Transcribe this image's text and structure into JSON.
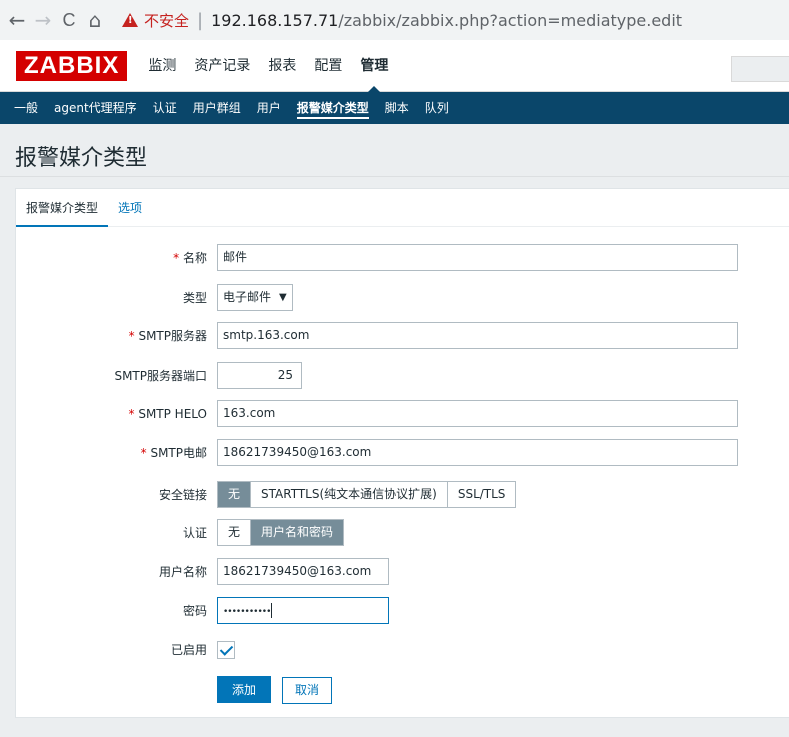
{
  "browser": {
    "back": "←",
    "forward": "→",
    "reload": "C",
    "home": "⌂",
    "security_label": "不安全",
    "host": "192.168.157.71",
    "path": "/zabbix/zabbix.php?action=mediatype.edit"
  },
  "header": {
    "logo": "ZABBIX",
    "menu": [
      "监测",
      "资产记录",
      "报表",
      "配置",
      "管理"
    ],
    "active_menu": "管理"
  },
  "subnav": {
    "items": [
      "一般",
      "agent代理程序",
      "认证",
      "用户群组",
      "用户",
      "报警媒介类型",
      "脚本",
      "队列"
    ],
    "active": "报警媒介类型"
  },
  "page": {
    "title": "报警媒介类型"
  },
  "tabs": {
    "tab1": "报警媒介类型",
    "tab2": "选项"
  },
  "form": {
    "name": {
      "label": "名称",
      "value": "邮件"
    },
    "type": {
      "label": "类型",
      "value": "电子邮件"
    },
    "smtp_server": {
      "label": "SMTP服务器",
      "value": "smtp.163.com"
    },
    "smtp_port": {
      "label": "SMTP服务器端口",
      "value": "25"
    },
    "smtp_helo": {
      "label": "SMTP HELO",
      "value": "163.com"
    },
    "smtp_email": {
      "label": "SMTP电邮",
      "value": "18621739450@163.com"
    },
    "security": {
      "label": "安全链接",
      "options": [
        "无",
        "STARTTLS(纯文本通信协议扩展)",
        "SSL/TLS"
      ],
      "selected": "无"
    },
    "auth": {
      "label": "认证",
      "options": [
        "无",
        "用户名和密码"
      ],
      "selected": "用户名和密码"
    },
    "username": {
      "label": "用户名称",
      "value": "18621739450@163.com"
    },
    "password": {
      "label": "密码",
      "value": "•••••••••••"
    },
    "enabled": {
      "label": "已启用",
      "checked": true
    },
    "add_button": "添加",
    "cancel_button": "取消"
  },
  "colors": {
    "brand_red": "#d40000",
    "nav_blue": "#0a466a",
    "link_blue": "#0275b8",
    "segment_active": "#768d99"
  }
}
